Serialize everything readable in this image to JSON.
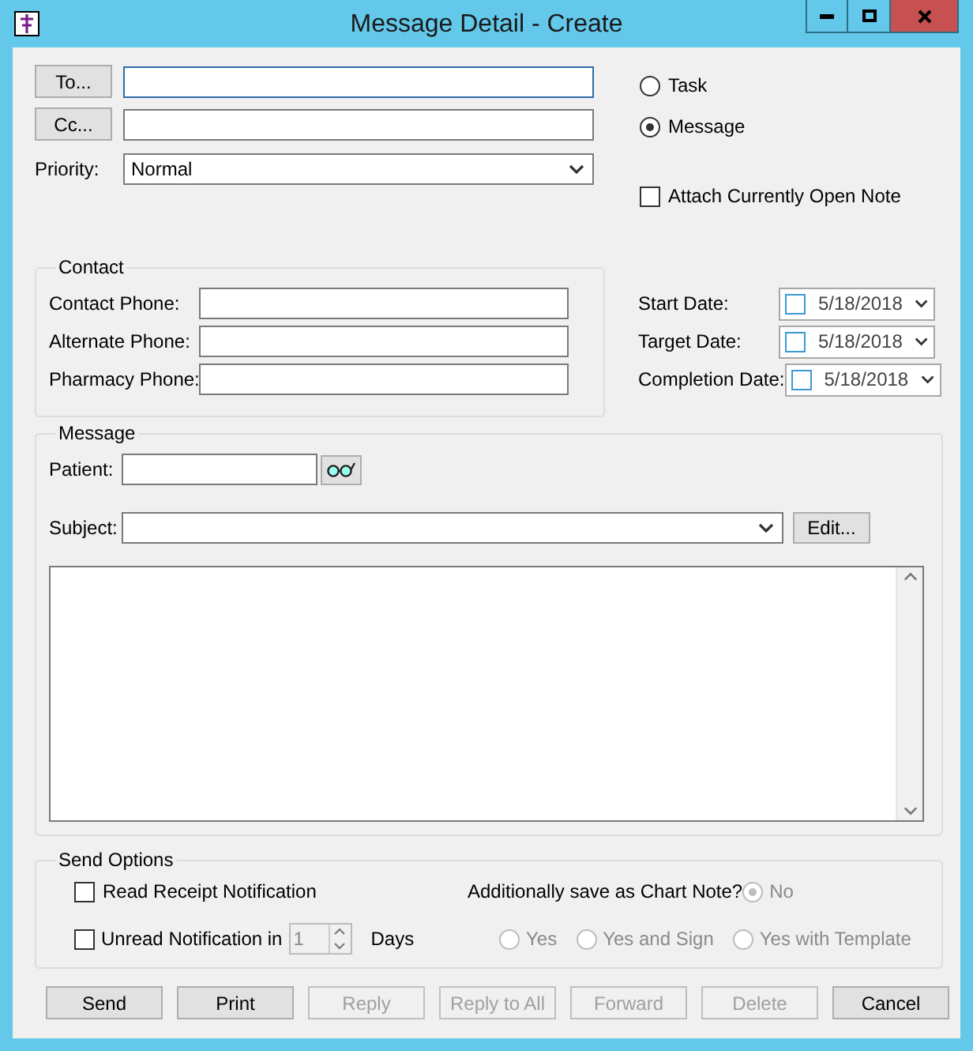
{
  "window": {
    "title": "Message Detail - Create"
  },
  "recipient_buttons": [
    "To...",
    "Cc..."
  ],
  "priority": {
    "label": "Priority:",
    "value": "Normal"
  },
  "type_options": [
    {
      "label": "Task",
      "selected": false
    },
    {
      "label": "Message",
      "selected": true
    }
  ],
  "attach_note": {
    "label": "Attach Currently Open Note",
    "checked": false
  },
  "contact": {
    "title": "Contact",
    "fields": [
      "Contact Phone:",
      "Alternate Phone:",
      "Pharmacy Phone:"
    ]
  },
  "dates": [
    {
      "label": "Start Date:",
      "value": "5/18/2018",
      "checked": false
    },
    {
      "label": "Target Date:",
      "value": "5/18/2018",
      "checked": false
    },
    {
      "label": "Completion Date:",
      "value": "5/18/2018",
      "checked": false
    }
  ],
  "message": {
    "title": "Message",
    "patient_label": "Patient:",
    "subject_label": "Subject:",
    "edit_button": "Edit..."
  },
  "send_options": {
    "title": "Send Options",
    "read_receipt": {
      "label": "Read Receipt Notification",
      "checked": false
    },
    "unread": {
      "label": "Unread Notification in",
      "value": "1",
      "unit": "Days",
      "checked": false,
      "disabled": true
    },
    "chart_note": {
      "label": "Additionally save as Chart Note?",
      "disabled": true,
      "options": [
        {
          "label": "No",
          "selected": true
        },
        {
          "label": "Yes",
          "selected": false
        },
        {
          "label": "Yes and Sign",
          "selected": false
        },
        {
          "label": "Yes with Template",
          "selected": false
        }
      ]
    }
  },
  "buttons": [
    {
      "label": "Send",
      "disabled": false
    },
    {
      "label": "Print",
      "disabled": false
    },
    {
      "label": "Reply",
      "disabled": true
    },
    {
      "label": "Reply to All",
      "disabled": true
    },
    {
      "label": "Forward",
      "disabled": true
    },
    {
      "label": "Delete",
      "disabled": true
    },
    {
      "label": "Cancel",
      "disabled": false
    }
  ]
}
